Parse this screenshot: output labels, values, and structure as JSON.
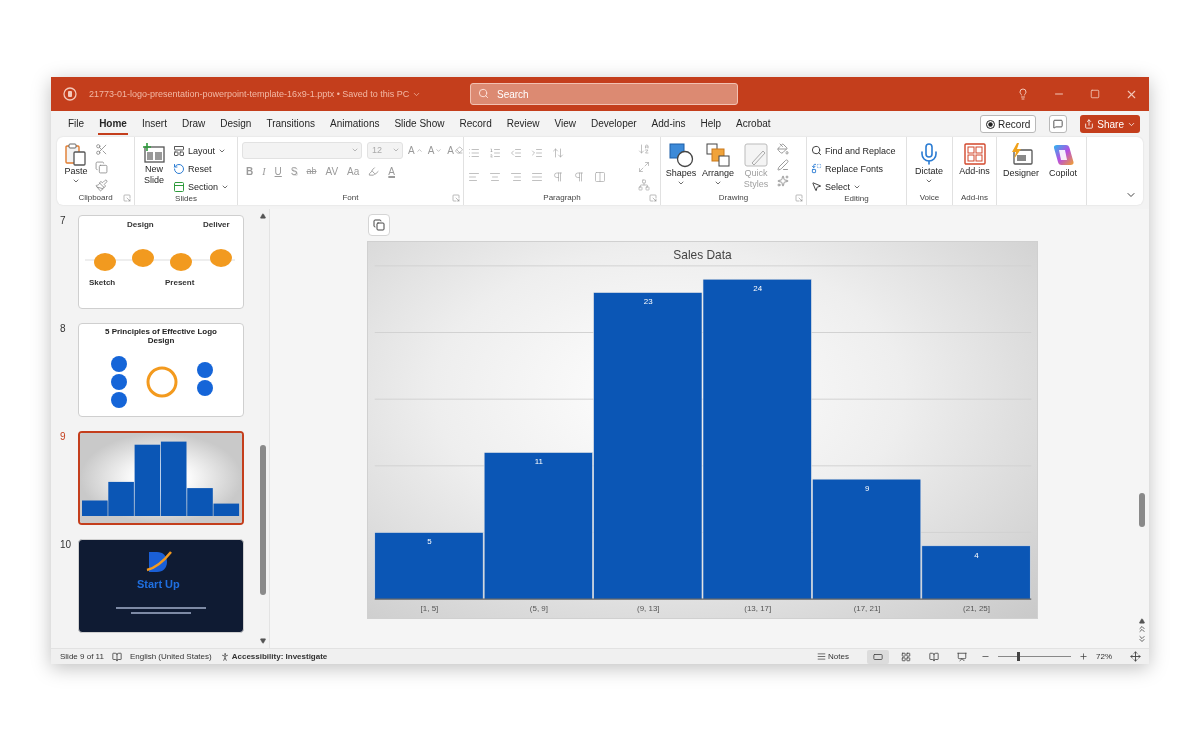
{
  "window": {
    "title": "21773-01-logo-presentation-powerpoint-template-16x9-1.pptx • Saved to this PC",
    "search": {
      "placeholder": "Search"
    }
  },
  "tabs": [
    {
      "label": "File",
      "selected": false
    },
    {
      "label": "Home",
      "selected": true
    },
    {
      "label": "Insert",
      "selected": false
    },
    {
      "label": "Draw",
      "selected": false
    },
    {
      "label": "Design",
      "selected": false
    },
    {
      "label": "Transitions",
      "selected": false
    },
    {
      "label": "Animations",
      "selected": false
    },
    {
      "label": "Slide Show",
      "selected": false
    },
    {
      "label": "Record",
      "selected": false
    },
    {
      "label": "Review",
      "selected": false
    },
    {
      "label": "View",
      "selected": false
    },
    {
      "label": "Developer",
      "selected": false
    },
    {
      "label": "Add-ins",
      "selected": false
    },
    {
      "label": "Help",
      "selected": false
    },
    {
      "label": "Acrobat",
      "selected": false
    }
  ],
  "tab_actions": {
    "record": "Record",
    "share": "Share"
  },
  "ribbon": {
    "clipboard": {
      "label": "Clipboard",
      "paste": "Paste"
    },
    "slides": {
      "label": "Slides",
      "new_slide": "New Slide",
      "layout": "Layout",
      "reset": "Reset",
      "section": "Section"
    },
    "font": {
      "label": "Font",
      "disabled": true,
      "font_size": "12",
      "size_buttons": [
        {
          "label": "A",
          "kind": "grow"
        },
        {
          "label": "A",
          "kind": "shrink"
        },
        {
          "label": "A",
          "kind": "clear"
        }
      ],
      "format_buttons": [
        {
          "label": "B",
          "kind": "bold"
        },
        {
          "label": "I",
          "kind": "italic"
        },
        {
          "label": "U",
          "kind": "underline"
        },
        {
          "label": "S",
          "kind": "shadow"
        },
        {
          "label": "ab",
          "kind": "strike"
        },
        {
          "label": "AV",
          "kind": "spacing"
        },
        {
          "label": "Aa",
          "kind": "case"
        },
        {
          "label": "A",
          "kind": "color"
        }
      ]
    },
    "paragraph": {
      "label": "Paragraph",
      "disabled": true
    },
    "drawing": {
      "label": "Drawing",
      "shapes": "Shapes",
      "arrange": "Arrange",
      "quick_styles": {
        "label": "Quick Styles",
        "disabled": true
      }
    },
    "editing": {
      "label": "Editing",
      "find_replace": "Find and Replace",
      "replace_fonts": "Replace Fonts",
      "select": "Select"
    },
    "voice": {
      "label": "Voice",
      "dictate": "Dictate"
    },
    "addins": {
      "label": "Add-ins",
      "addins": "Add-ins"
    },
    "designer": "Designer",
    "copilot": "Copilot"
  },
  "slides": [
    {
      "number": "7",
      "selected": false,
      "kind": "process",
      "texts": [
        "Design",
        "Deliver",
        "Sketch",
        "Present"
      ]
    },
    {
      "number": "8",
      "selected": false,
      "kind": "principles",
      "title": "5 Principles of Effective Logo Design"
    },
    {
      "number": "9",
      "selected": true,
      "kind": "chart"
    },
    {
      "number": "10",
      "selected": false,
      "kind": "cover",
      "title": "Start Up"
    }
  ],
  "slide": {
    "chart_data": {
      "type": "bar",
      "title": "Sales Data",
      "categories": [
        "[1, 5]",
        "(5, 9]",
        "(9, 13]",
        "(13, 17]",
        "(17, 21]",
        "(21, 25]"
      ],
      "values": [
        5,
        11,
        23,
        24,
        9,
        4
      ],
      "ylim": [
        0,
        25
      ],
      "data_labels": true
    }
  },
  "status_bar": {
    "slide_info": "Slide 9 of 11",
    "language": "English (United States)",
    "accessibility": "Accessibility: Investigate",
    "notes": "Notes",
    "views": [
      {
        "kind": "normal",
        "selected": true
      },
      {
        "kind": "sorter",
        "selected": false
      },
      {
        "kind": "reading",
        "selected": false
      },
      {
        "kind": "slideshow",
        "selected": false
      }
    ],
    "zoom": {
      "level": 0.28,
      "reading": "72%"
    }
  }
}
